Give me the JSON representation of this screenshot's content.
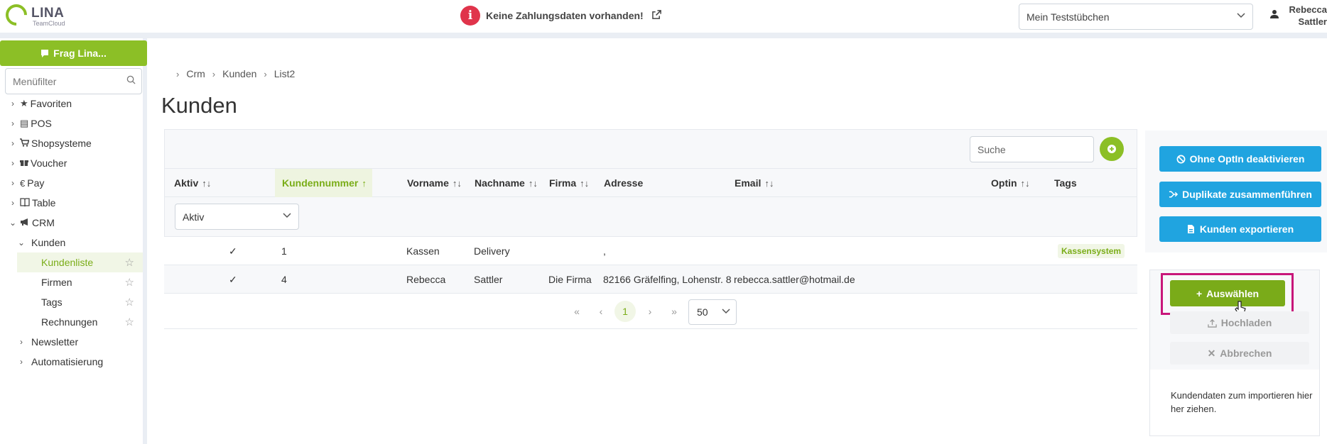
{
  "header": {
    "logo_name": "LINA",
    "logo_sub": "TeamCloud",
    "alert_text": "Keine Zahlungsdaten vorhanden!",
    "alert_icon": "info-icon",
    "shop_select_value": "Mein Teststübchen",
    "user_name_line1": "Rebecca",
    "user_name_line2": "Sattler"
  },
  "sidebar": {
    "frag_label": "Frag Lina...",
    "menu_filter_placeholder": "Menüfilter",
    "items": [
      {
        "label": "Favoriten",
        "icon": "star-icon"
      },
      {
        "label": "POS",
        "icon": "cash-register-icon"
      },
      {
        "label": "Shopsysteme",
        "icon": "cart-icon"
      },
      {
        "label": "Voucher",
        "icon": "gift-icon"
      },
      {
        "label": "Pay",
        "icon": "euro-icon"
      },
      {
        "label": "Table",
        "icon": "book-icon"
      },
      {
        "label": "CRM",
        "icon": "megaphone-icon"
      },
      {
        "label": "Kunden"
      },
      {
        "label": "Kundenliste"
      },
      {
        "label": "Firmen"
      },
      {
        "label": "Tags"
      },
      {
        "label": "Rechnungen"
      },
      {
        "label": "Newsletter"
      },
      {
        "label": "Automatisierung"
      }
    ]
  },
  "breadcrumb": [
    "Crm",
    "Kunden",
    "List2"
  ],
  "page_title": "Kunden",
  "table": {
    "search_placeholder": "Suche",
    "headers": [
      "Aktiv",
      "Kundennummer",
      "Vorname",
      "Nachname",
      "Firma",
      "Adresse",
      "Email",
      "Optin",
      "Tags"
    ],
    "aktiv_filter": "Aktiv",
    "rows": [
      {
        "aktiv": "✓",
        "kundennummer": "1",
        "vorname": "Kassen",
        "nachname": "Delivery",
        "firma": "",
        "adresse": ",",
        "email": "",
        "optin": "",
        "tag": "Kassensystem"
      },
      {
        "aktiv": "✓",
        "kundennummer": "4",
        "vorname": "Rebecca",
        "nachname": "Sattler",
        "firma": "Die Firma",
        "adresse": "82166 Gräfelfing, Lohenstr. 8",
        "email": "rebecca.sattler@hotmail.de",
        "optin": "",
        "tag": ""
      }
    ],
    "pagination": {
      "current_page": "1",
      "per_page": "50"
    }
  },
  "actions": {
    "optin_label": "Ohne OptIn deaktivieren",
    "duplicates_label": "Duplikate zusammenführen",
    "export_label": "Kunden exportieren"
  },
  "upload": {
    "select_label": "Auswählen",
    "upload_label": "Hochladen",
    "cancel_label": "Abbrechen",
    "drop_text": "Kundendaten zum importieren hier her ziehen."
  },
  "colors": {
    "brand_green": "#8cbf26",
    "action_blue": "#20a4e0",
    "alert_red": "#e0344b",
    "highlight_magenta": "#c8167a"
  }
}
